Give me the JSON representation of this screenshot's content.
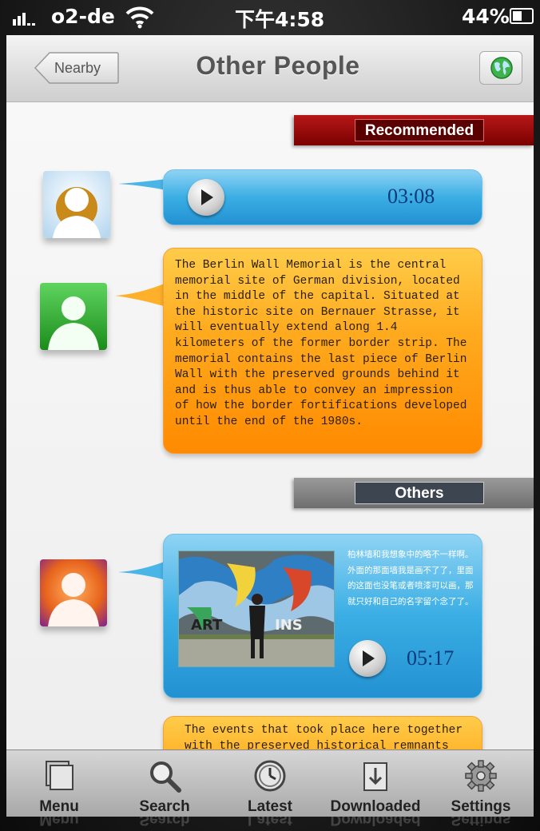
{
  "status_bar": {
    "carrier": "o2-de",
    "time": "下午4:58",
    "battery": "44%"
  },
  "nav": {
    "back_label": "Nearby",
    "title": "Other People",
    "right_icon": "globe-icon"
  },
  "sections": {
    "recommended_label": "Recommended",
    "others_label": "Others"
  },
  "messages": [
    {
      "type": "audio",
      "duration": "03:08",
      "avatar_color": "#c98a1a"
    },
    {
      "type": "text",
      "avatar_color": "#2fa82f",
      "text": "The Berlin Wall Memorial is the central memorial site of German division, located in the middle of the capital. Situated at the historic site on Bernauer Strasse, it will eventually extend along 1.4 kilometers of the former border strip. The memorial contains the last piece of Berlin Wall with the preserved grounds behind it and is thus able to convey an impression of how the border fortifications developed until the end of the 1980s."
    },
    {
      "type": "photo_audio",
      "duration": "05:17",
      "avatar_color": "#e8641c",
      "caption": "柏林墙和我想象中的略不一样啊。外面的那面墙我是画不了了，里面的这面也没笔或者喷漆可以画，那就只好和自己的名字留个念了了。"
    },
    {
      "type": "text",
      "avatar_color": "#ffab1f",
      "text": "The events that took place here together with the preserved historical remnants"
    }
  ],
  "tabs": [
    {
      "label": "Menu",
      "icon": "menu-icon"
    },
    {
      "label": "Search",
      "icon": "search-icon"
    },
    {
      "label": "Latest",
      "icon": "clock-icon"
    },
    {
      "label": "Downloaded",
      "icon": "download-icon"
    },
    {
      "label": "Settings",
      "icon": "gear-icon"
    }
  ]
}
